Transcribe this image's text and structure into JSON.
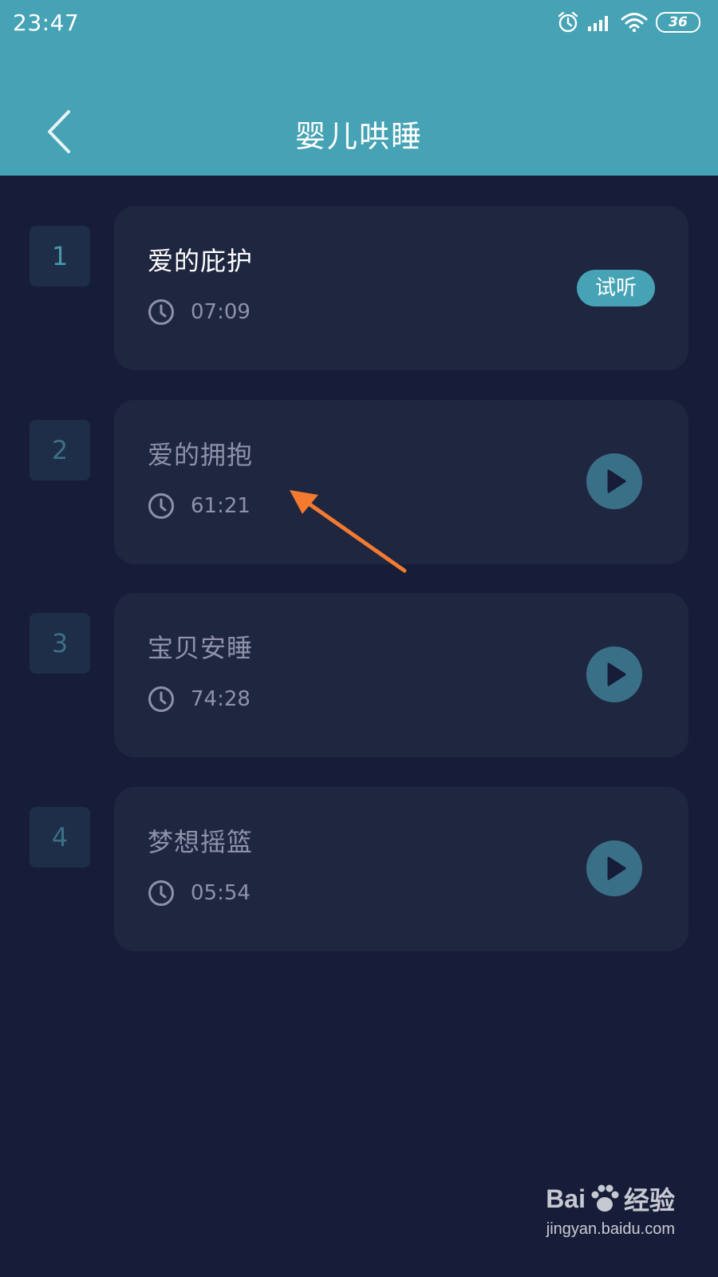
{
  "status_bar": {
    "time": "23:47",
    "battery": "36",
    "icons": [
      "alarm-icon",
      "signal-icon",
      "wifi-icon",
      "battery-icon"
    ]
  },
  "header": {
    "title": "婴儿哄睡",
    "back_icon": "chevron-left-icon",
    "background": "#46a3b5"
  },
  "tracks": [
    {
      "index": "1",
      "title": "爱的庇护",
      "duration": "07:09",
      "action": "试听"
    },
    {
      "index": "2",
      "title": "爱的拥抱",
      "duration": "61:21",
      "action": "play"
    },
    {
      "index": "3",
      "title": "宝贝安睡",
      "duration": "74:28",
      "action": "play"
    },
    {
      "index": "4",
      "title": "梦想摇篮",
      "duration": "05:54",
      "action": "play"
    }
  ],
  "colors": {
    "background": "#171d38",
    "card": "#1f2640",
    "accent": "#46a3b5",
    "annotation_arrow": "#f47a30"
  },
  "watermark": {
    "brand": "Bai",
    "brand_suffix": "经验",
    "url": "jingyan.baidu.com"
  }
}
